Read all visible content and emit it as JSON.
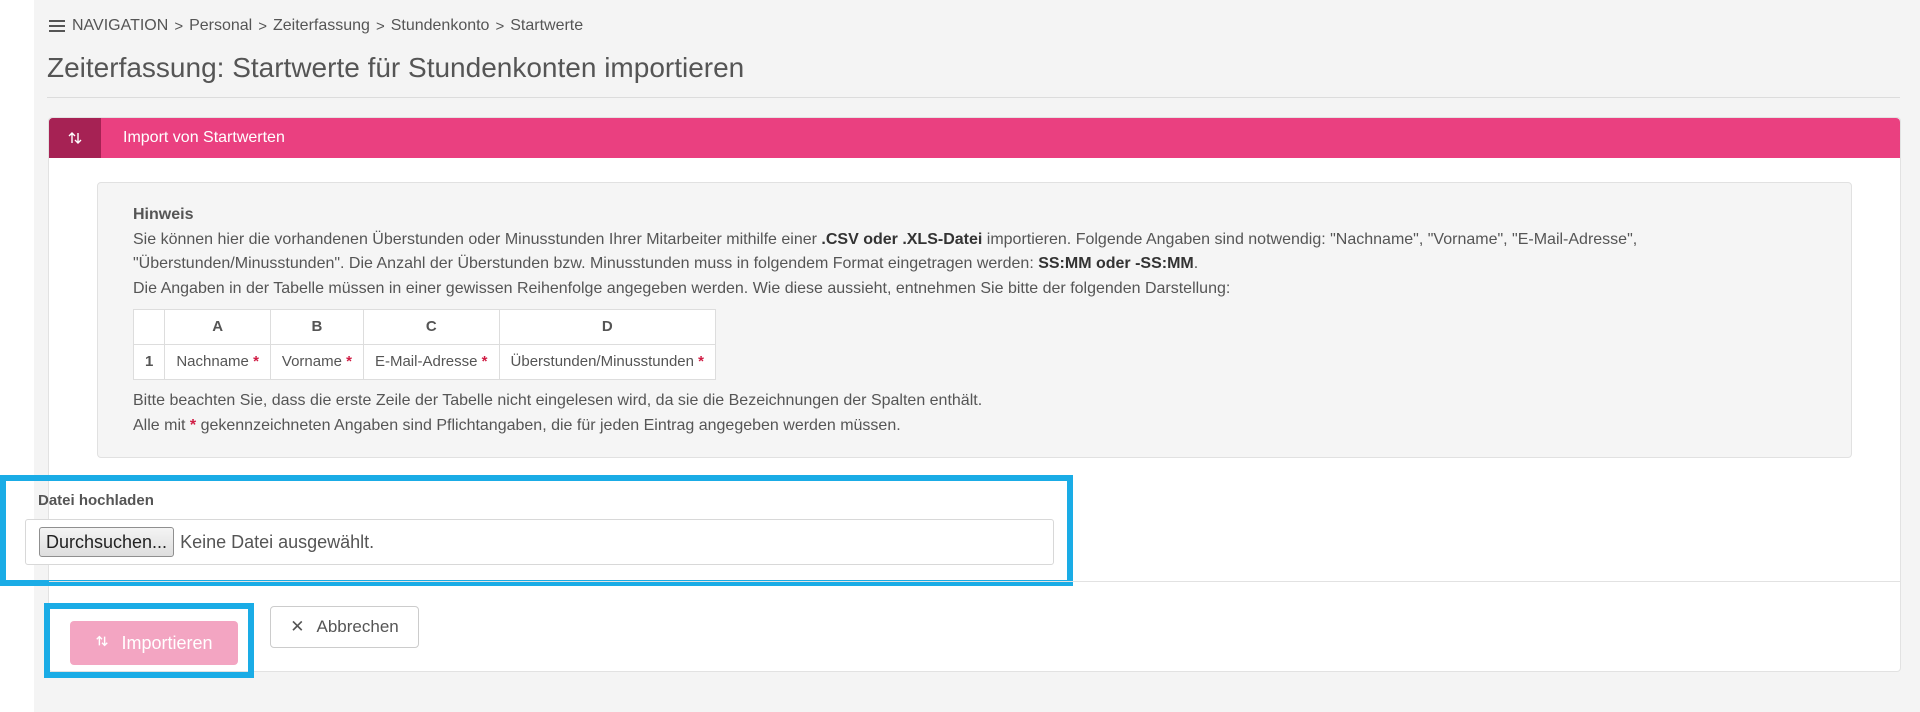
{
  "breadcrumb": {
    "nav_label": "NAVIGATION",
    "items": [
      "Personal",
      "Zeiterfassung",
      "Stundenkonto",
      "Startwerte"
    ],
    "separator": ">"
  },
  "page_title": "Zeiterfassung: Startwerte für Stundenkonten importieren",
  "panel": {
    "icon": "import-arrows-icon",
    "title": "Import von Startwerten"
  },
  "hint": {
    "title": "Hinweis",
    "line1_a": "Sie können hier die vorhandenen Überstunden oder Minusstunden Ihrer Mitarbeiter mithilfe einer ",
    "line1_b": ".CSV oder .XLS-Datei",
    "line1_c": " importieren. Folgende Angaben sind notwendig: \"Nachname\", \"Vorname\", \"E-Mail-Adresse\", \"Überstunden/Minusstunden\". Die Anzahl der Überstunden bzw. Minusstunden muss in folgendem Format eingetragen werden: ",
    "line1_d": "SS:MM oder -SS:MM",
    "line1_e": ".",
    "line2": "Die Angaben in der Tabelle müssen in einer gewissen Reihenfolge angegeben werden. Wie diese aussieht, entnehmen Sie bitte der folgenden Darstellung:",
    "table": {
      "headers": [
        "",
        "A",
        "B",
        "C",
        "D"
      ],
      "row_number": "1",
      "cells": [
        "Nachname",
        "Vorname",
        "E-Mail-Adresse",
        "Überstunden/Minusstunden"
      ],
      "required_mark": "*"
    },
    "note1": "Bitte beachten Sie, dass die erste Zeile der Tabelle nicht eingelesen wird, da sie die Bezeichnungen der Spalten enthält.",
    "note2_a": "Alle mit ",
    "note2_star": "*",
    "note2_b": " gekennzeichneten Angaben sind Pflichtangaben, die für jeden Eintrag angegeben werden müssen."
  },
  "upload": {
    "label": "Datei hochladen",
    "browse_label": "Durchsuchen...",
    "no_file_text": "Keine Datei ausgewählt."
  },
  "actions": {
    "import_label": "Importieren",
    "import_icon": "import-arrows-icon",
    "cancel_label": "Abbrechen",
    "cancel_icon": "close-icon"
  },
  "colors": {
    "accent": "#ea4080",
    "accent_dark": "#a62254",
    "highlight": "#1aace6",
    "disabled_button": "#f3a5c2",
    "required": "#d01c44"
  }
}
